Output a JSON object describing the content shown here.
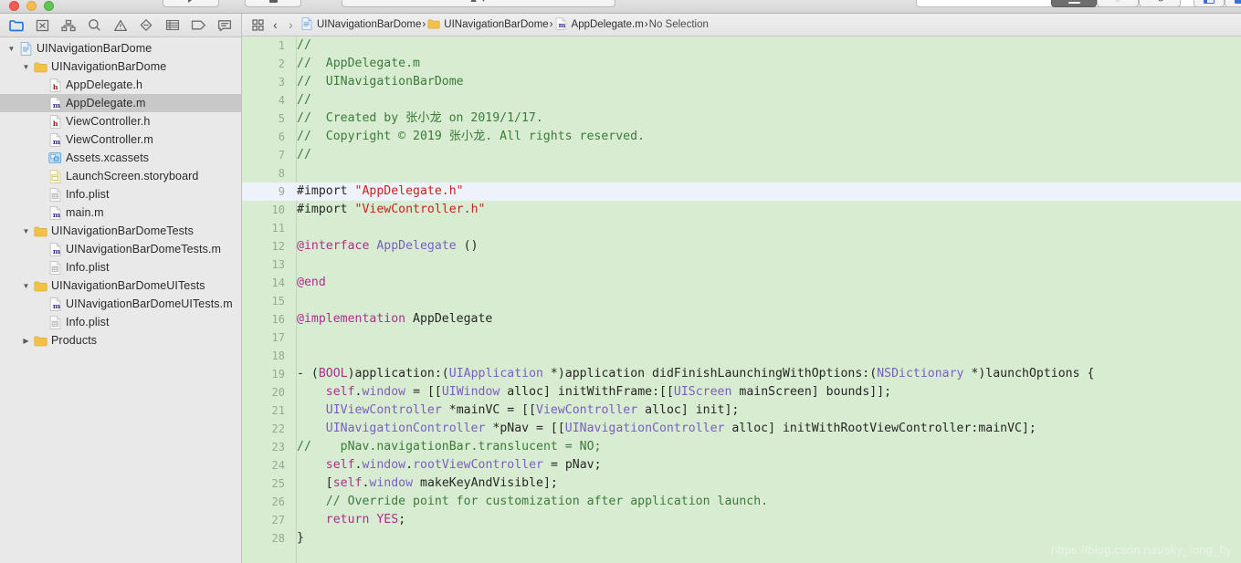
{
  "window": {
    "traffic_lights": [
      "close",
      "minimize",
      "maximize"
    ]
  },
  "toolbar": {
    "buttons": [
      {
        "name": "run-button",
        "icon": "play-triangle"
      },
      {
        "name": "stop-button",
        "icon": "stop-square"
      },
      {
        "name": "scheme-button",
        "icon": "scheme-swatch"
      },
      {
        "name": "destination-button",
        "icon": "device-chevron"
      },
      {
        "name": "activity-view",
        "icon": "activity-panel"
      },
      {
        "name": "editor-standard-button",
        "icon": "editor-standard"
      },
      {
        "name": "editor-assistant-button",
        "icon": "editor-assistant"
      },
      {
        "name": "editor-version-button",
        "icon": "editor-version"
      },
      {
        "name": "toggle-navigator-button",
        "icon": "panel-left"
      },
      {
        "name": "toggle-debug-button",
        "icon": "panel-bottom"
      },
      {
        "name": "toggle-utilities-button",
        "icon": "panel-right"
      }
    ]
  },
  "navigator": {
    "tabs": [
      {
        "name": "project-navigator",
        "icon": "folder-icon",
        "active": true
      },
      {
        "name": "source-control-navigator",
        "icon": "source-control-icon",
        "active": false
      },
      {
        "name": "symbol-navigator",
        "icon": "hierarchy-icon",
        "active": false
      },
      {
        "name": "find-navigator",
        "icon": "search-icon",
        "active": false
      },
      {
        "name": "issue-navigator",
        "icon": "warning-icon",
        "active": false
      },
      {
        "name": "test-navigator",
        "icon": "diamond-icon",
        "active": false
      },
      {
        "name": "debug-navigator",
        "icon": "list-icon",
        "active": false
      },
      {
        "name": "breakpoint-navigator",
        "icon": "tag-icon",
        "active": false
      },
      {
        "name": "report-navigator",
        "icon": "speech-icon",
        "active": false
      }
    ],
    "tree": [
      {
        "label": "UINavigationBarDome",
        "indent": 0,
        "twisty": "open",
        "icon": "xcodeproj-icon",
        "selected": false
      },
      {
        "label": "UINavigationBarDome",
        "indent": 1,
        "twisty": "open",
        "icon": "folder-icon",
        "selected": false
      },
      {
        "label": "AppDelegate.h",
        "indent": 2,
        "twisty": "none",
        "icon": "h-file-icon",
        "selected": false
      },
      {
        "label": "AppDelegate.m",
        "indent": 2,
        "twisty": "none",
        "icon": "m-file-icon",
        "selected": true
      },
      {
        "label": "ViewController.h",
        "indent": 2,
        "twisty": "none",
        "icon": "h-file-icon",
        "selected": false
      },
      {
        "label": "ViewController.m",
        "indent": 2,
        "twisty": "none",
        "icon": "m-file-icon",
        "selected": false
      },
      {
        "label": "Assets.xcassets",
        "indent": 2,
        "twisty": "none",
        "icon": "xcassets-icon",
        "selected": false
      },
      {
        "label": "LaunchScreen.storyboard",
        "indent": 2,
        "twisty": "none",
        "icon": "storyboard-icon",
        "selected": false
      },
      {
        "label": "Info.plist",
        "indent": 2,
        "twisty": "none",
        "icon": "plist-icon",
        "selected": false
      },
      {
        "label": "main.m",
        "indent": 2,
        "twisty": "none",
        "icon": "m-file-icon",
        "selected": false
      },
      {
        "label": "UINavigationBarDomeTests",
        "indent": 1,
        "twisty": "open",
        "icon": "folder-icon",
        "selected": false
      },
      {
        "label": "UINavigationBarDomeTests.m",
        "indent": 2,
        "twisty": "none",
        "icon": "m-file-icon",
        "selected": false
      },
      {
        "label": "Info.plist",
        "indent": 2,
        "twisty": "none",
        "icon": "plist-icon",
        "selected": false
      },
      {
        "label": "UINavigationBarDomeUITests",
        "indent": 1,
        "twisty": "open",
        "icon": "folder-icon",
        "selected": false
      },
      {
        "label": "UINavigationBarDomeUITests.m",
        "indent": 2,
        "twisty": "none",
        "icon": "m-file-icon",
        "selected": false
      },
      {
        "label": "Info.plist",
        "indent": 2,
        "twisty": "none",
        "icon": "plist-icon",
        "selected": false
      },
      {
        "label": "Products",
        "indent": 1,
        "twisty": "closed",
        "icon": "folder-icon",
        "selected": false
      }
    ]
  },
  "jumpbar": {
    "related_items_icon": "grid-icon",
    "back_label": "‹",
    "forward_label": "›",
    "breadcrumbs": [
      {
        "label": "UINavigationBarDome",
        "icon": "xcodeproj-icon"
      },
      {
        "label": "UINavigationBarDome",
        "icon": "folder-icon"
      },
      {
        "label": "AppDelegate.m",
        "icon": "m-file-icon"
      },
      {
        "label": "No Selection",
        "icon": "none"
      }
    ],
    "separator": "›"
  },
  "editor": {
    "filename": "AppDelegate.m",
    "current_line": 9,
    "background_color": "#d8ecd1",
    "current_line_color": "#edf2fb",
    "gutter_color": "#96a896",
    "syntax_colors": {
      "comment": "#3c7a3c",
      "string": "#c3261f",
      "keyword": "#ac2e8f",
      "type": "#7a5fc0",
      "plain": "#262626"
    },
    "lines": [
      {
        "n": 1,
        "tokens": [
          {
            "t": "//",
            "c": "c-com"
          }
        ]
      },
      {
        "n": 2,
        "tokens": [
          {
            "t": "//  AppDelegate.m",
            "c": "c-com"
          }
        ]
      },
      {
        "n": 3,
        "tokens": [
          {
            "t": "//  UINavigationBarDome",
            "c": "c-com"
          }
        ]
      },
      {
        "n": 4,
        "tokens": [
          {
            "t": "//",
            "c": "c-com"
          }
        ]
      },
      {
        "n": 5,
        "tokens": [
          {
            "t": "//  Created by 张小龙 on 2019/1/17.",
            "c": "c-com"
          }
        ]
      },
      {
        "n": 6,
        "tokens": [
          {
            "t": "//  Copyright © 2019 张小龙. All rights reserved.",
            "c": "c-com"
          }
        ]
      },
      {
        "n": 7,
        "tokens": [
          {
            "t": "//",
            "c": "c-com"
          }
        ]
      },
      {
        "n": 8,
        "tokens": []
      },
      {
        "n": 9,
        "tokens": [
          {
            "t": "#import ",
            "c": "c-pln"
          },
          {
            "t": "\"AppDelegate.h\"",
            "c": "c-str"
          }
        ]
      },
      {
        "n": 10,
        "tokens": [
          {
            "t": "#import ",
            "c": "c-pln"
          },
          {
            "t": "\"ViewController.h\"",
            "c": "c-str"
          }
        ]
      },
      {
        "n": 11,
        "tokens": []
      },
      {
        "n": 12,
        "tokens": [
          {
            "t": "@interface",
            "c": "c-key"
          },
          {
            "t": " ",
            "c": "c-pln"
          },
          {
            "t": "AppDelegate",
            "c": "c-type"
          },
          {
            "t": " ()",
            "c": "c-pln"
          }
        ]
      },
      {
        "n": 13,
        "tokens": []
      },
      {
        "n": 14,
        "tokens": [
          {
            "t": "@end",
            "c": "c-key"
          }
        ]
      },
      {
        "n": 15,
        "tokens": []
      },
      {
        "n": 16,
        "tokens": [
          {
            "t": "@implementation",
            "c": "c-key"
          },
          {
            "t": " AppDelegate",
            "c": "c-pln"
          }
        ]
      },
      {
        "n": 17,
        "tokens": []
      },
      {
        "n": 18,
        "tokens": []
      },
      {
        "n": 19,
        "tokens": [
          {
            "t": "- (",
            "c": "c-pln"
          },
          {
            "t": "BOOL",
            "c": "c-key"
          },
          {
            "t": ")application:(",
            "c": "c-pln"
          },
          {
            "t": "UIApplication",
            "c": "c-type"
          },
          {
            "t": " *)application didFinishLaunchingWithOptions:(",
            "c": "c-pln"
          },
          {
            "t": "NSDictionary",
            "c": "c-type"
          },
          {
            "t": " *)launchOptions {",
            "c": "c-pln"
          }
        ]
      },
      {
        "n": 20,
        "tokens": [
          {
            "t": "    ",
            "c": "c-pln"
          },
          {
            "t": "self",
            "c": "c-key"
          },
          {
            "t": ".",
            "c": "c-pln"
          },
          {
            "t": "window",
            "c": "c-type"
          },
          {
            "t": " = [[",
            "c": "c-pln"
          },
          {
            "t": "UIWindow",
            "c": "c-type"
          },
          {
            "t": " alloc] initWithFrame:[[",
            "c": "c-pln"
          },
          {
            "t": "UIScreen",
            "c": "c-type"
          },
          {
            "t": " mainScreen] bounds]];",
            "c": "c-pln"
          }
        ]
      },
      {
        "n": 21,
        "tokens": [
          {
            "t": "    ",
            "c": "c-pln"
          },
          {
            "t": "UIViewController",
            "c": "c-type"
          },
          {
            "t": " *mainVC = [[",
            "c": "c-pln"
          },
          {
            "t": "ViewController",
            "c": "c-type"
          },
          {
            "t": " alloc] init];",
            "c": "c-pln"
          }
        ]
      },
      {
        "n": 22,
        "tokens": [
          {
            "t": "    ",
            "c": "c-pln"
          },
          {
            "t": "UINavigationController",
            "c": "c-type"
          },
          {
            "t": " *pNav = [[",
            "c": "c-pln"
          },
          {
            "t": "UINavigationController",
            "c": "c-type"
          },
          {
            "t": " alloc] initWithRootViewController:mainVC];",
            "c": "c-pln"
          }
        ]
      },
      {
        "n": 23,
        "tokens": [
          {
            "t": "//    pNav.navigationBar.translucent = NO;",
            "c": "c-com"
          }
        ]
      },
      {
        "n": 24,
        "tokens": [
          {
            "t": "    ",
            "c": "c-pln"
          },
          {
            "t": "self",
            "c": "c-key"
          },
          {
            "t": ".",
            "c": "c-pln"
          },
          {
            "t": "window",
            "c": "c-type"
          },
          {
            "t": ".",
            "c": "c-pln"
          },
          {
            "t": "rootViewController",
            "c": "c-type"
          },
          {
            "t": " = pNav;",
            "c": "c-pln"
          }
        ]
      },
      {
        "n": 25,
        "tokens": [
          {
            "t": "    [",
            "c": "c-pln"
          },
          {
            "t": "self",
            "c": "c-key"
          },
          {
            "t": ".",
            "c": "c-pln"
          },
          {
            "t": "window",
            "c": "c-type"
          },
          {
            "t": " makeKeyAndVisible];",
            "c": "c-pln"
          }
        ]
      },
      {
        "n": 26,
        "tokens": [
          {
            "t": "    ",
            "c": "c-pln"
          },
          {
            "t": "// Override point for customization after application launch.",
            "c": "c-com"
          }
        ]
      },
      {
        "n": 27,
        "tokens": [
          {
            "t": "    ",
            "c": "c-pln"
          },
          {
            "t": "return",
            "c": "c-key"
          },
          {
            "t": " ",
            "c": "c-pln"
          },
          {
            "t": "YES",
            "c": "c-key"
          },
          {
            "t": ";",
            "c": "c-pln"
          }
        ]
      },
      {
        "n": 28,
        "tokens": [
          {
            "t": "}",
            "c": "c-pln"
          }
        ]
      }
    ]
  },
  "watermark": {
    "text": "https://blog.csdn.net/sky_long_fly"
  }
}
